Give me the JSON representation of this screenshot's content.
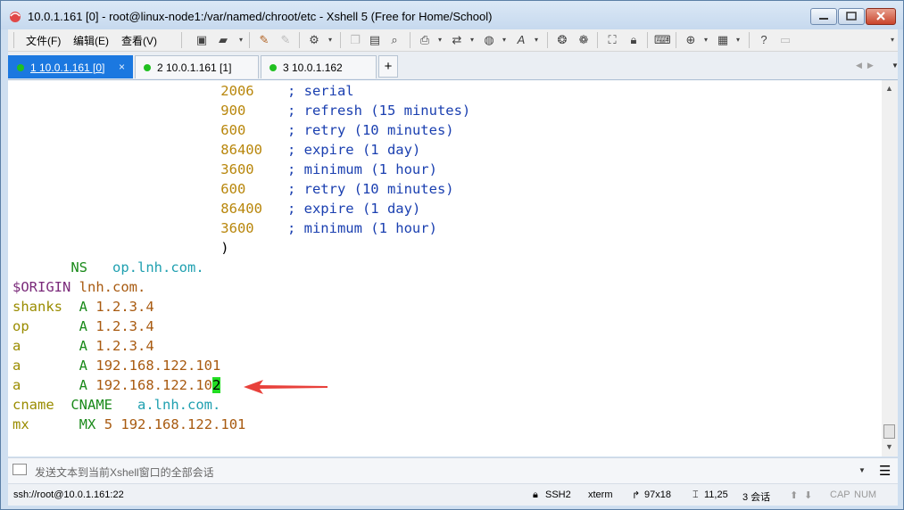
{
  "window": {
    "title": "10.0.1.161 [0] - root@linux-node1:/var/named/chroot/etc - Xshell 5 (Free for Home/School)"
  },
  "menubar": {
    "items": [
      {
        "label": "文件(F)"
      },
      {
        "label": "编辑(E)"
      },
      {
        "label": "查看(V)"
      }
    ]
  },
  "tabs": [
    {
      "label": "1 10.0.1.161 [0]",
      "status_color": "#20c020",
      "active": true
    },
    {
      "label": "2 10.0.1.161 [1]",
      "status_color": "#20c020",
      "active": false
    },
    {
      "label": "3 10.0.1.162",
      "status_color": "#20c020",
      "active": false
    }
  ],
  "tab_close_glyph": "×",
  "new_tab_glyph": "+",
  "terminal": {
    "soa": [
      {
        "value": "2006",
        "comment": "; serial"
      },
      {
        "value": "900",
        "comment": "; refresh (15 minutes)"
      },
      {
        "value": "600",
        "comment": "; retry (10 minutes)"
      },
      {
        "value": "86400",
        "comment": "; expire (1 day)"
      },
      {
        "value": "3600",
        "comment": "; minimum (1 hour)"
      },
      {
        "value": "600",
        "comment": "; retry (10 minutes)"
      },
      {
        "value": "86400",
        "comment": "; expire (1 day)"
      },
      {
        "value": "3600",
        "comment": "; minimum (1 hour)"
      }
    ],
    "close_paren": ")",
    "ns": {
      "type": "NS",
      "value": "op.lnh.com."
    },
    "origin": {
      "directive": "$ORIGIN",
      "value": "lnh.com."
    },
    "records": [
      {
        "name": "shanks",
        "type": "A",
        "value": "1.2.3.4"
      },
      {
        "name": "op",
        "type": "A",
        "value": "1.2.3.4"
      },
      {
        "name": "a",
        "type": "A",
        "value": "1.2.3.4"
      },
      {
        "name": "a",
        "type": "A",
        "value": "192.168.122.101"
      }
    ],
    "cursor_record": {
      "name": "a",
      "type": "A",
      "value_before_cursor": "192.168.122.10",
      "cursor_char": "2"
    },
    "cname": {
      "name": "cname",
      "type": "CNAME",
      "value": "a.lnh.com."
    },
    "mx": {
      "name": "mx",
      "type": "MX",
      "priority": "5",
      "value": "192.168.122.101"
    }
  },
  "colors": {
    "cursor": "#22dd22",
    "active_tab": "#1b78e0",
    "annotation_arrow": "#e8413b"
  },
  "compose_bar": {
    "placeholder": "发送文本到当前Xshell窗口的全部会话"
  },
  "statusbar": {
    "connection": "ssh://root@10.0.1.161:22",
    "protocol": "SSH2",
    "terminal_type": "xterm",
    "size": "97x18",
    "cursor_pos": "11,25",
    "sessions": "3 会话",
    "caps": "CAP",
    "num": "NUM"
  }
}
